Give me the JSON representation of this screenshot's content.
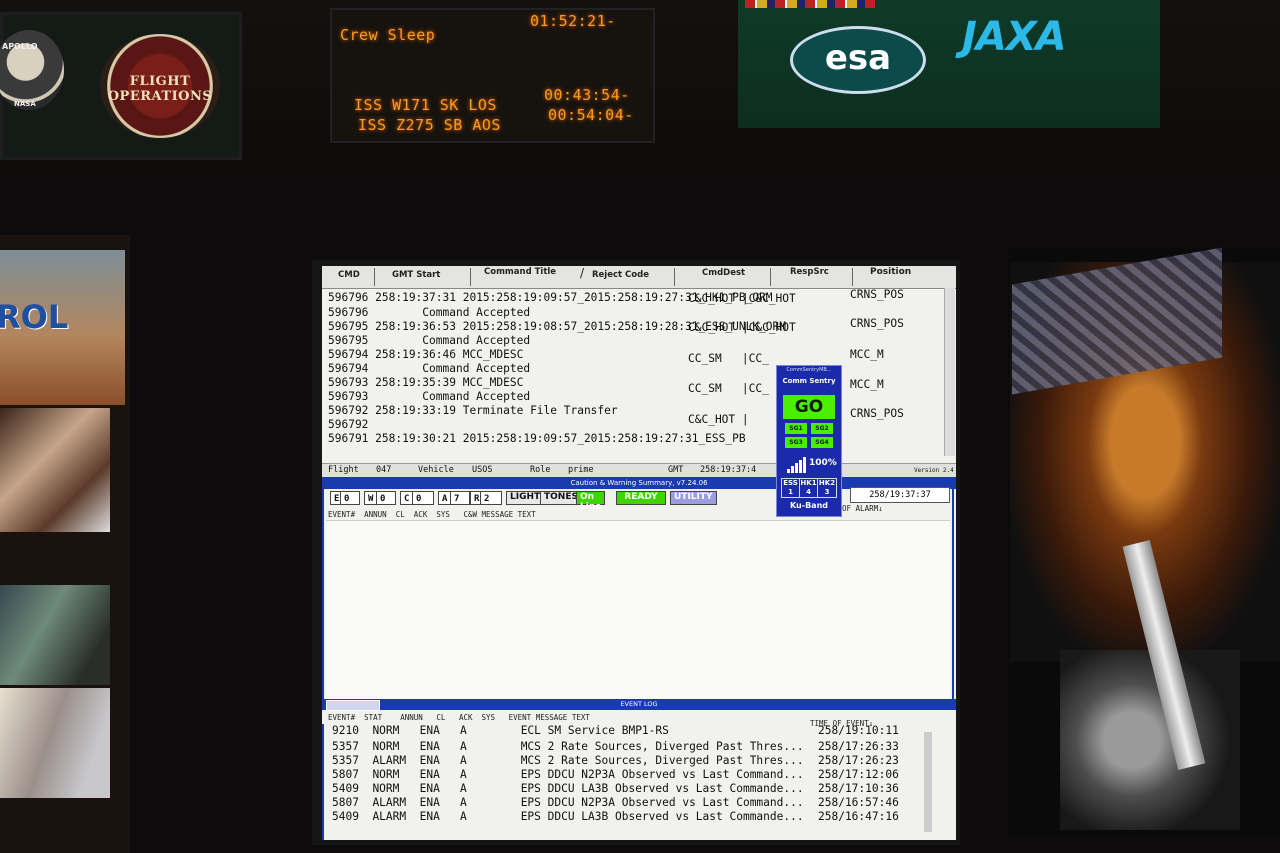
{
  "ops_display": {
    "crew_label": "Crew Sleep",
    "crew_time": "01:52:21-",
    "los_label": "ISS W171 SK LOS",
    "los_time": "00:43:54-",
    "aos_label": "ISS Z275 SB AOS",
    "aos_time": "00:54:04-"
  },
  "logos": {
    "apollo": "APOLLO",
    "nasa": "NASA",
    "flight_ops": "FLIGHT OPERATIONS",
    "esa": "esa",
    "jaxa": "JAXA"
  },
  "poster": {
    "text": "ROL"
  },
  "command_window": {
    "columns": [
      "CMD",
      "GMT Start",
      "Command Title",
      "Reject Code",
      "CmdDest",
      "RespSrc",
      "Position"
    ],
    "lines": [
      {
        "left": "596796 258:19:37:31 2015:258:19:09:57_2015:258:19:27:31_HK1_PB_ORM",
        "right": "",
        "pos": ""
      },
      {
        "left": "",
        "right": "C&C_HOT |C&C_HOT",
        "pos": "CRNS_POS"
      },
      {
        "left": "596796        Command Accepted",
        "right": "",
        "pos": ""
      },
      {
        "left": "596795 258:19:36:53 2015:258:19:08:57_2015:258:19:28:31_ESS_UNLK_ORM",
        "right": "",
        "pos": ""
      },
      {
        "left": "",
        "right": "C&C_HOT |C&C_HOT",
        "pos": "CRNS_POS"
      },
      {
        "left": "596795        Command Accepted",
        "right": "",
        "pos": ""
      },
      {
        "left": "596794 258:19:36:46 MCC_MDESC",
        "right": "CC_SM   |CC_",
        "pos": "MCC_M"
      },
      {
        "left": "596794        Command Accepted",
        "right": "",
        "pos": ""
      },
      {
        "left": "596793 258:19:35:39 MCC_MDESC",
        "right": "CC_SM   |CC_",
        "pos": "MCC_M"
      },
      {
        "left": "596793        Command Accepted",
        "right": "",
        "pos": ""
      },
      {
        "left": "596792 258:19:33:19 Terminate File Transfer",
        "right": "",
        "pos": ""
      },
      {
        "left": "596792",
        "right": "C&C_HOT |",
        "pos": "CRNS_POS"
      },
      {
        "left": "596791 258:19:30:21 2015:258:19:09:57_2015:258:19:27:31_ESS_PB",
        "right": "",
        "pos": ""
      }
    ],
    "status": {
      "flight_label": "Flight",
      "flight": "047",
      "vehicle_label": "Vehicle",
      "vehicle": "USOS",
      "role_label": "Role",
      "role": "prime",
      "gmt_label": "GMT",
      "gmt": "258:19:37:4",
      "version": "Version 2.4"
    }
  },
  "cw_summary": {
    "title": "Caution & Warning Summary, v7.24.06",
    "counts": [
      {
        "k": "E",
        "v": "0"
      },
      {
        "k": "W",
        "v": "0"
      },
      {
        "k": "C",
        "v": "0"
      },
      {
        "k": "A",
        "v": "7"
      },
      {
        "k": "R",
        "v": "2"
      }
    ],
    "lights": "LIGHTS",
    "tones": "TONES",
    "online": "On Line",
    "ready": "READY",
    "utility": "UTILITY",
    "time": "258/19:37:37",
    "columns": "EVENT#  ANNUN  CL  ACK  SYS   C&W MESSAGE TEXT",
    "time_col": "OF ALARM↓"
  },
  "event_log": {
    "title": "EVENT LOG",
    "columns": "EVENT#  STAT    ANNUN   CL   ACK  SYS   EVENT MESSAGE TEXT",
    "time_col": "TIME OF EVENT↓",
    "rows": [
      {
        "num": "9210",
        "stat": "NORM",
        "annun": "ENA",
        "cl": "A",
        "msg": "ECL SM Service BMP1-RS",
        "time": "258/19:10:11"
      },
      {
        "num": "5357",
        "stat": "NORM",
        "annun": "ENA",
        "cl": "A",
        "msg": "MCS 2 Rate Sources, Diverged Past Thres...",
        "time": "258/17:26:33"
      },
      {
        "num": "5357",
        "stat": "ALARM",
        "annun": "ENA",
        "cl": "A",
        "msg": "MCS 2 Rate Sources, Diverged Past Thres...",
        "time": "258/17:26:23"
      },
      {
        "num": "5807",
        "stat": "NORM",
        "annun": "ENA",
        "cl": "A",
        "msg": "EPS DDCU N2P3A Observed vs Last Command...",
        "time": "258/17:12:06"
      },
      {
        "num": "5409",
        "stat": "NORM",
        "annun": "ENA",
        "cl": "A",
        "msg": "EPS DDCU LA3B Observed vs Last Commande...",
        "time": "258/17:10:36"
      },
      {
        "num": "5807",
        "stat": "ALARM",
        "annun": "ENA",
        "cl": "A",
        "msg": "EPS DDCU N2P3A Observed vs Last Command...",
        "time": "258/16:57:46"
      },
      {
        "num": "5409",
        "stat": "ALARM",
        "annun": "ENA",
        "cl": "A",
        "msg": "EPS DDCU LA3B Observed vs Last Commande...",
        "time": "258/16:47:16"
      }
    ]
  },
  "comm_sentry": {
    "window_title": "CommSentryMB...",
    "name": "Comm Sentry",
    "status": "GO",
    "sg": [
      "SG1",
      "SG2",
      "SG3",
      "SG4"
    ],
    "signal_pct": "100%",
    "bands": [
      {
        "k": "ESS",
        "v": "1"
      },
      {
        "k": "HK1",
        "v": "4"
      },
      {
        "k": "HK2",
        "v": "3"
      }
    ],
    "band": "Ku-Band",
    "colors": {
      "go": "#48f000",
      "panel": "#1a2aa8"
    }
  },
  "colors": {
    "led": "#ff9a1e",
    "title_bar": "#1a3bb0",
    "online": "#3fd400",
    "ready": "#3fd400",
    "utility": "#9c9ce0"
  }
}
